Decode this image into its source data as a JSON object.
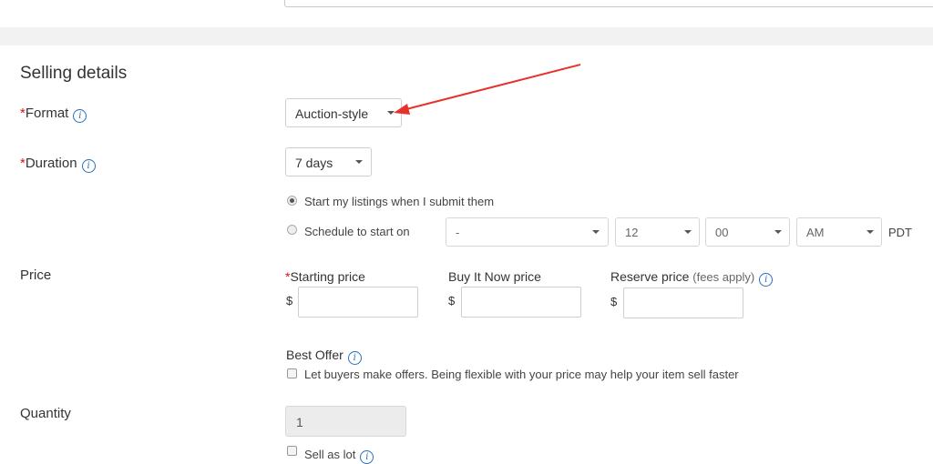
{
  "selling_details": {
    "title": "Selling details",
    "format": {
      "label": "Format",
      "value": "Auction-style"
    },
    "duration": {
      "label": "Duration",
      "value": "7 days"
    },
    "start_options": {
      "now_label": "Start my listings when I submit them",
      "schedule_label": "Schedule to start on",
      "date_value": "-",
      "hour_value": "12",
      "minute_value": "00",
      "ampm_value": "AM",
      "timezone": "PDT"
    },
    "price": {
      "label": "Price",
      "starting_label": "Starting price",
      "buy_now_label": "Buy It Now price",
      "reserve_label": "Reserve price",
      "reserve_note": "(fees apply)",
      "currency": "$"
    },
    "best_offer": {
      "label": "Best Offer",
      "checkbox_label": "Let buyers make offers. Being flexible with your price may help your item sell faster"
    },
    "quantity": {
      "label": "Quantity",
      "value": "1",
      "sell_as_lot_label": "Sell as lot"
    }
  },
  "required_marker": "*",
  "info_glyph": "i",
  "colors": {
    "required": "#d11",
    "info": "#2a6ebd",
    "annotation_arrow": "#e8312a"
  }
}
